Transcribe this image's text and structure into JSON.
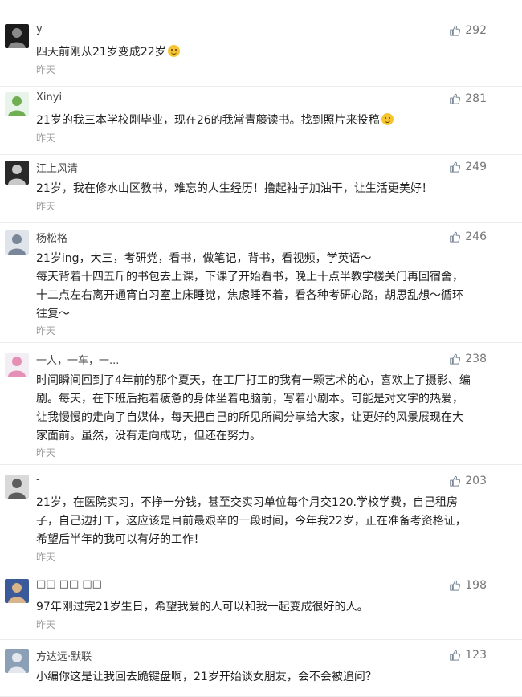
{
  "comments": [
    {
      "user": "y",
      "likes": "292",
      "lines": [
        "四天前刚从21岁变成22岁"
      ],
      "time": "昨天",
      "emoji": true,
      "avatar_colors": [
        "#1b1b1b",
        "#8a8a8a"
      ]
    },
    {
      "user": "Xinyi",
      "likes": "281",
      "lines": [
        "21岁的我三本学校刚毕业，现在26的我常青藤读书。找到照片来投稿"
      ],
      "time": "昨天",
      "emoji": true,
      "avatar_colors": [
        "#e8f4ea",
        "#6fae52"
      ]
    },
    {
      "user": "江上风清",
      "likes": "249",
      "lines": [
        "21岁，我在修水山区教书，难忘的人生经历！撸起袖子加油干，让生活更美好！"
      ],
      "time": "昨天",
      "emoji": false,
      "avatar_colors": [
        "#2a2a2a",
        "#c9c9c9"
      ]
    },
    {
      "user": "杨松格",
      "likes": "246",
      "lines": [
        "21岁ing，大三，考研党，看书，做笔记，背书，看视频，学英语～",
        "每天背着十四五斤的书包去上课，下课了开始看书，晚上十点半教学楼关门再回宿舍，",
        "十二点左右离开通宵自习室上床睡觉，焦虑睡不着，看各种考研心路，胡思乱想～循环",
        "往复～"
      ],
      "time": "昨天",
      "emoji": false,
      "avatar_colors": [
        "#dfe3ea",
        "#7a869a"
      ]
    },
    {
      "user": "一人，一车，一...",
      "likes": "238",
      "lines": [
        "时间瞬间回到了4年前的那个夏天，在工厂打工的我有一颗艺术的心，喜欢上了摄影、编",
        "剧。每天，在下班后拖着疲惫的身体坐着电脑前，写着小剧本。可能是对文字的热爱，",
        "让我慢慢的走向了自媒体，每天把自己的所见所闻分享给大家，让更好的风景展现在大",
        "家面前。虽然，没有走向成功，但还在努力。"
      ],
      "time": "昨天",
      "emoji": false,
      "avatar_colors": [
        "#f3eef3",
        "#e58fb6"
      ]
    },
    {
      "user": "-",
      "likes": "203",
      "lines": [
        "21岁，在医院实习，不挣一分钱，甚至交实习单位每个月交120.学校学费，自己租房",
        "子，自己边打工，这应该是目前最艰辛的一段时间，今年我22岁，正在准备考资格证，",
        "希望后半年的我可以有好的工作！"
      ],
      "time": "昨天",
      "emoji": false,
      "avatar_colors": [
        "#d9d9d9",
        "#5d5d5d"
      ]
    },
    {
      "user": "□□ □□ □□",
      "likes": "198",
      "lines": [
        "97年刚过完21岁生日，希望我爱的人可以和我一起变成很好的人。"
      ],
      "time": "昨天",
      "emoji": false,
      "avatar_colors": [
        "#3a5a9a",
        "#d8b48a"
      ]
    },
    {
      "user": "方达远·默联",
      "likes": "123",
      "lines": [
        "小编你这是让我回去跪键盘啊，21岁开始谈女朋友，会不会被追问？"
      ],
      "time": "",
      "emoji": false,
      "avatar_colors": [
        "#8b9fb7",
        "#e4e8ee"
      ]
    }
  ]
}
